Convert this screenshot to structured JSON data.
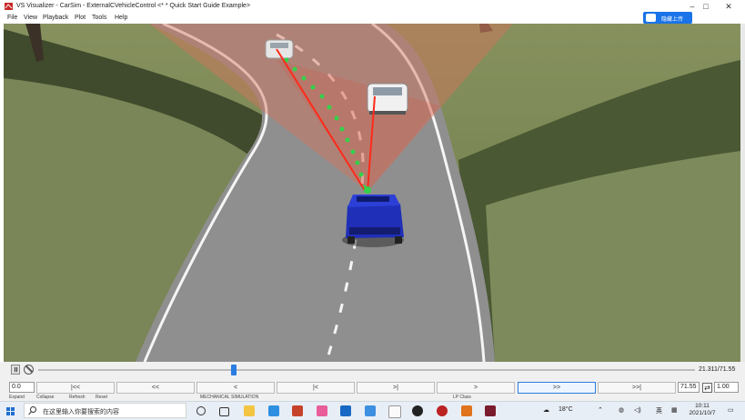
{
  "window": {
    "title": "VS Visualizer - CarSim - ExternalCVehicleControl <* * Quick Start Guide Example>",
    "minimize_glyph": "–",
    "maximize_glyph": "□",
    "close_glyph": "✕"
  },
  "menu": [
    "File",
    "View",
    "Playback",
    "Plot",
    "Tools",
    "Help"
  ],
  "overlay_button": {
    "label": "隐藏上传"
  },
  "playback": {
    "time_readout": "21.311/71.55",
    "current_time": 21.311,
    "total_time": 71.55,
    "start_value": "0.0",
    "end_value": "71.55",
    "speed_value": "1.00",
    "buttons": [
      "|<<",
      "<<",
      "<",
      "|<",
      ">|",
      ">",
      ">>",
      ">>|"
    ],
    "active_button": ">>"
  },
  "bottom_strip": {
    "expand": "Expand",
    "collapse": "Collapse",
    "refresh": "Refresh",
    "reset": "Reset",
    "section": "MECHANICAL SIMULATION",
    "extra": "LP Class"
  },
  "taskbar": {
    "search_placeholder": "在这里输入你要搜索的内容",
    "weather": "18°C",
    "ime": "英",
    "time": "10:11",
    "date": "2021/10/7"
  },
  "icons": {
    "app": "vs-visualizer-icon",
    "taskbar": [
      "windows-start-icon",
      "cortana-icon",
      "task-view-icon",
      "file-explorer-icon",
      "vscode-icon",
      "app-grid-icon",
      "paint-icon",
      "outlook-icon",
      "checkmark-app-icon",
      "typora-icon",
      "obs-icon",
      "media-icon",
      "matlab-icon",
      "carsim-icon"
    ]
  },
  "colors": {
    "accent": "#2b7de1",
    "grass": "#6b7a48",
    "road": "#8c8c8c",
    "sensor_cone": "#d8735a",
    "path_points": "#2ecc40",
    "ego_car": "#1f2fb8",
    "target_line": "#ff2a1a"
  }
}
